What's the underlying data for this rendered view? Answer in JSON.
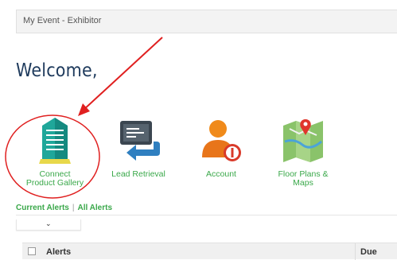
{
  "header": {
    "title": "My Event - Exhibitor"
  },
  "welcome": {
    "text": "Welcome,"
  },
  "tiles": [
    {
      "label": "Connect\nProduct Gallery",
      "icon": "building-icon"
    },
    {
      "label": "Lead Retrieval",
      "icon": "lead-retrieval-icon"
    },
    {
      "label": "Account",
      "icon": "account-icon"
    },
    {
      "label": "Floor Plans &\nMaps",
      "icon": "map-icon"
    }
  ],
  "alerts": {
    "current_label": "Current Alerts",
    "all_label": "All Alerts",
    "separator": "|"
  },
  "table": {
    "columns": [
      "Alerts",
      "Due"
    ]
  },
  "colors": {
    "accent_green": "#3aa84a",
    "title_navy": "#1e3a5c",
    "annotation_red": "#e02020"
  }
}
